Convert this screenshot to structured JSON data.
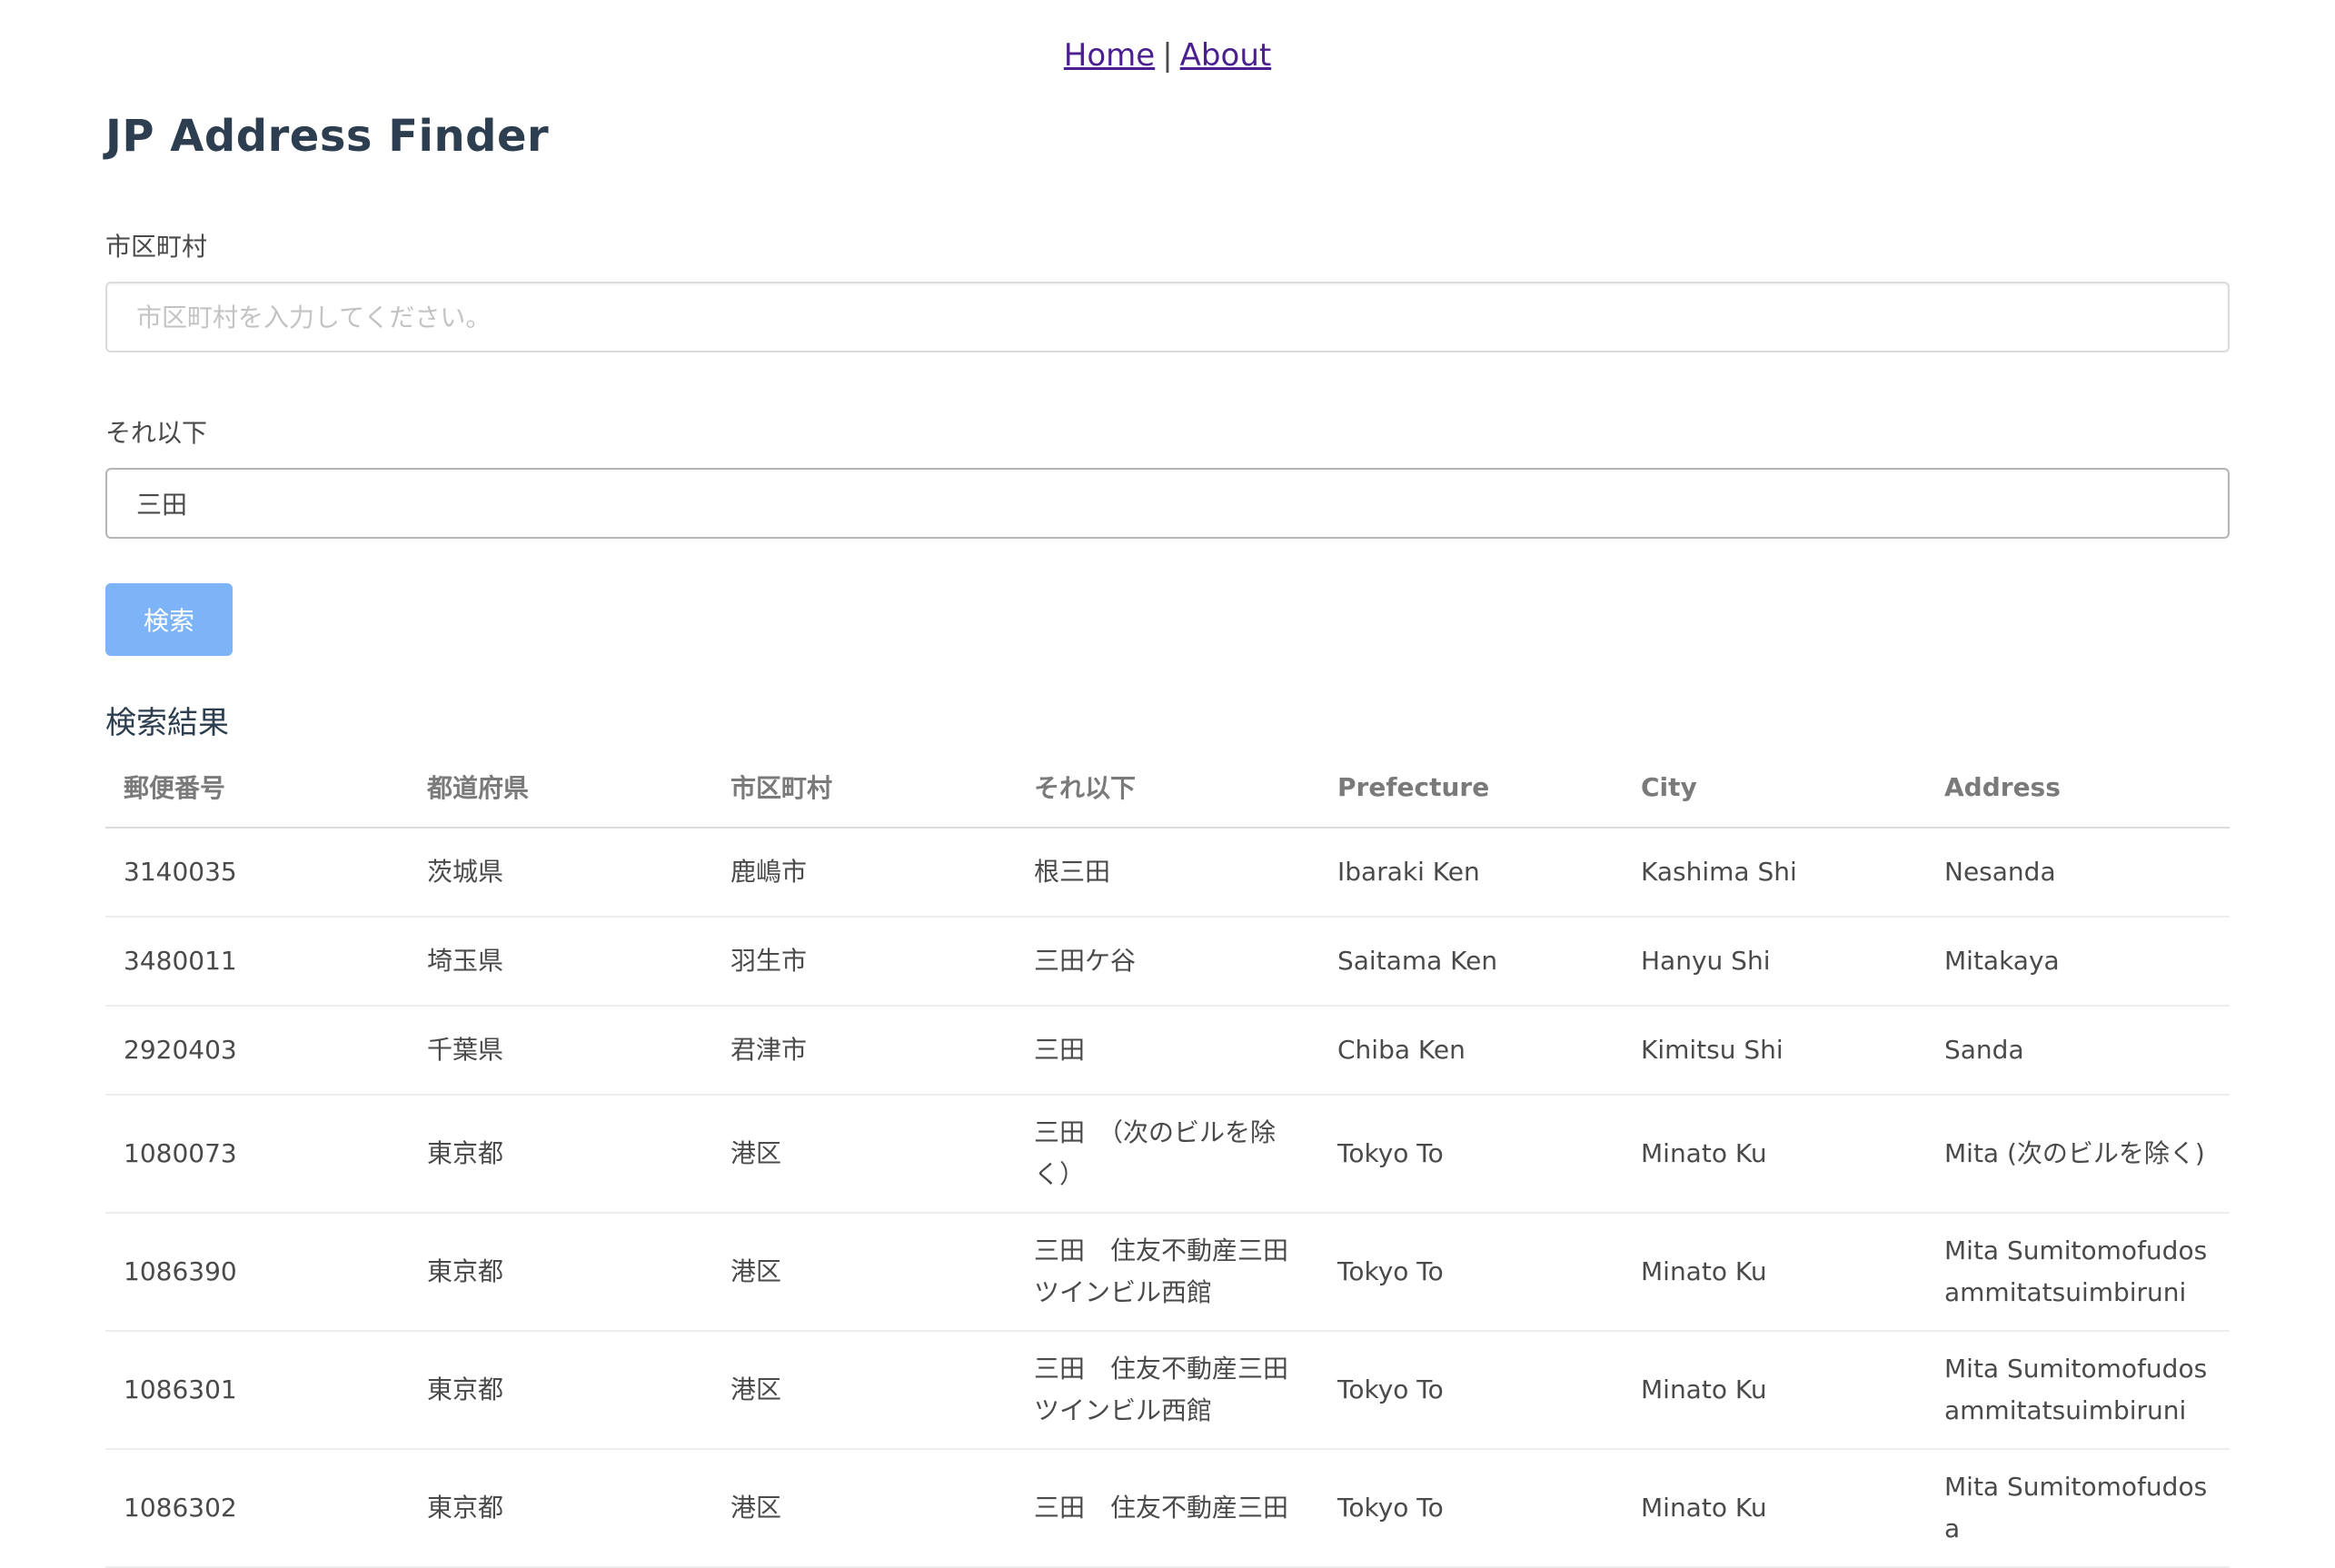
{
  "nav": {
    "home": "Home",
    "separator": "|",
    "about": "About"
  },
  "page": {
    "title": "JP Address Finder"
  },
  "form": {
    "city_label": "市区町村",
    "city_placeholder": "市区町村を入力してください。",
    "city_value": "",
    "below_label": "それ以下",
    "below_value": "三田",
    "search_button": "検索"
  },
  "results": {
    "title": "検索結果",
    "columns": [
      "郵便番号",
      "都道府県",
      "市区町村",
      "それ以下",
      "Prefecture",
      "City",
      "Address"
    ],
    "rows": [
      [
        "3140035",
        "茨城県",
        "鹿嶋市",
        "根三田",
        "Ibaraki Ken",
        "Kashima Shi",
        "Nesanda"
      ],
      [
        "3480011",
        "埼玉県",
        "羽生市",
        "三田ケ谷",
        "Saitama Ken",
        "Hanyu Shi",
        "Mitakaya"
      ],
      [
        "2920403",
        "千葉県",
        "君津市",
        "三田",
        "Chiba Ken",
        "Kimitsu Shi",
        "Sanda"
      ],
      [
        "1080073",
        "東京都",
        "港区",
        "三田　（次のビルを除く）",
        "Tokyo To",
        "Minato Ku",
        "Mita (次のビルを除く)"
      ],
      [
        "1086390",
        "東京都",
        "港区",
        "三田　住友不動産三田ツインビル西館",
        "Tokyo To",
        "Minato Ku",
        "Mita Sumitomofudosammitatsuimbiruni"
      ],
      [
        "1086301",
        "東京都",
        "港区",
        "三田　住友不動産三田ツインビル西館",
        "Tokyo To",
        "Minato Ku",
        "Mita Sumitomofudosammitatsuimbiruni"
      ],
      [
        "1086302",
        "東京都",
        "港区",
        "三田　住友不動産三田",
        "Tokyo To",
        "Minato Ku",
        "Mita Sumitomofudosa"
      ]
    ]
  },
  "colors": {
    "link": "#4b1f8f",
    "title": "#2d3e50",
    "button": "#7cb4f7"
  }
}
